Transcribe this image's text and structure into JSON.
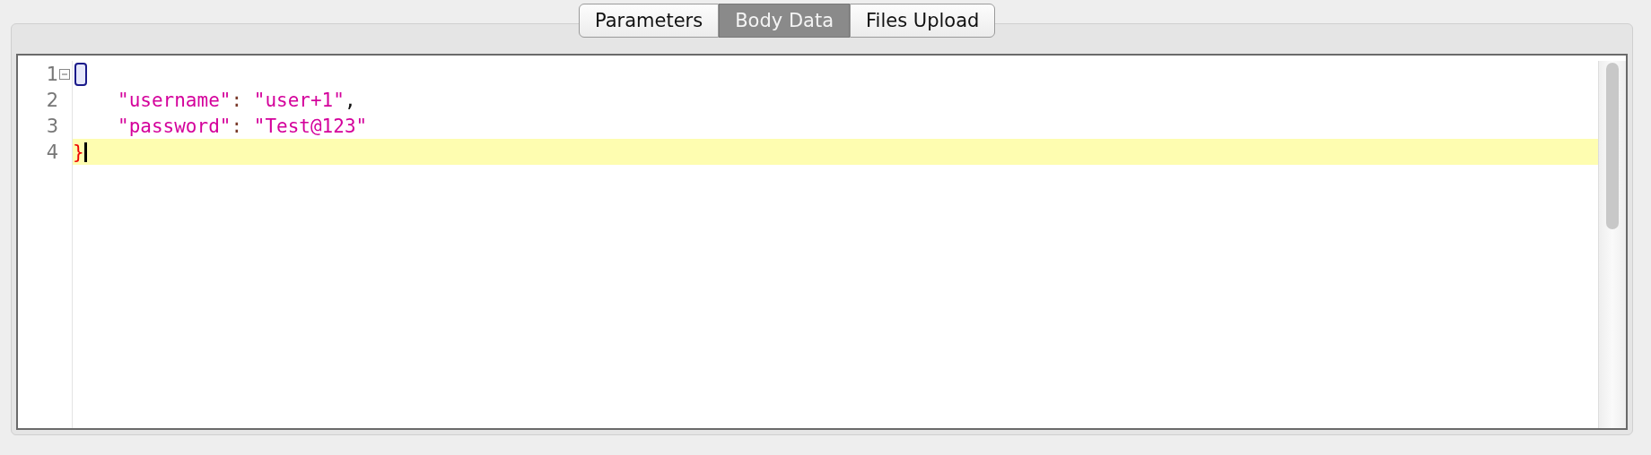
{
  "tabs": [
    {
      "label": "Parameters",
      "selected": false
    },
    {
      "label": "Body Data",
      "selected": true
    },
    {
      "label": "Files Upload",
      "selected": false
    }
  ],
  "editor": {
    "lines": [
      {
        "number": "1",
        "foldable": true,
        "bracket_box": true,
        "indented": false,
        "current": false
      },
      {
        "number": "2",
        "foldable": false,
        "bracket_box": false,
        "indented": true,
        "current": false,
        "tokens": [
          {
            "kind": "string",
            "text": "\"username\""
          },
          {
            "kind": "colon",
            "text": ": "
          },
          {
            "kind": "string",
            "text": "\"user+1\""
          },
          {
            "kind": "plain",
            "text": ","
          }
        ]
      },
      {
        "number": "3",
        "foldable": false,
        "bracket_box": false,
        "indented": true,
        "current": false,
        "tokens": [
          {
            "kind": "string",
            "text": "\"password\""
          },
          {
            "kind": "colon",
            "text": ": "
          },
          {
            "kind": "string",
            "text": "\"Test@123\""
          }
        ]
      },
      {
        "number": "4",
        "foldable": false,
        "bracket_box": false,
        "indented": false,
        "current": true,
        "tokens": [
          {
            "kind": "bracket",
            "text": "}"
          }
        ]
      }
    ]
  }
}
